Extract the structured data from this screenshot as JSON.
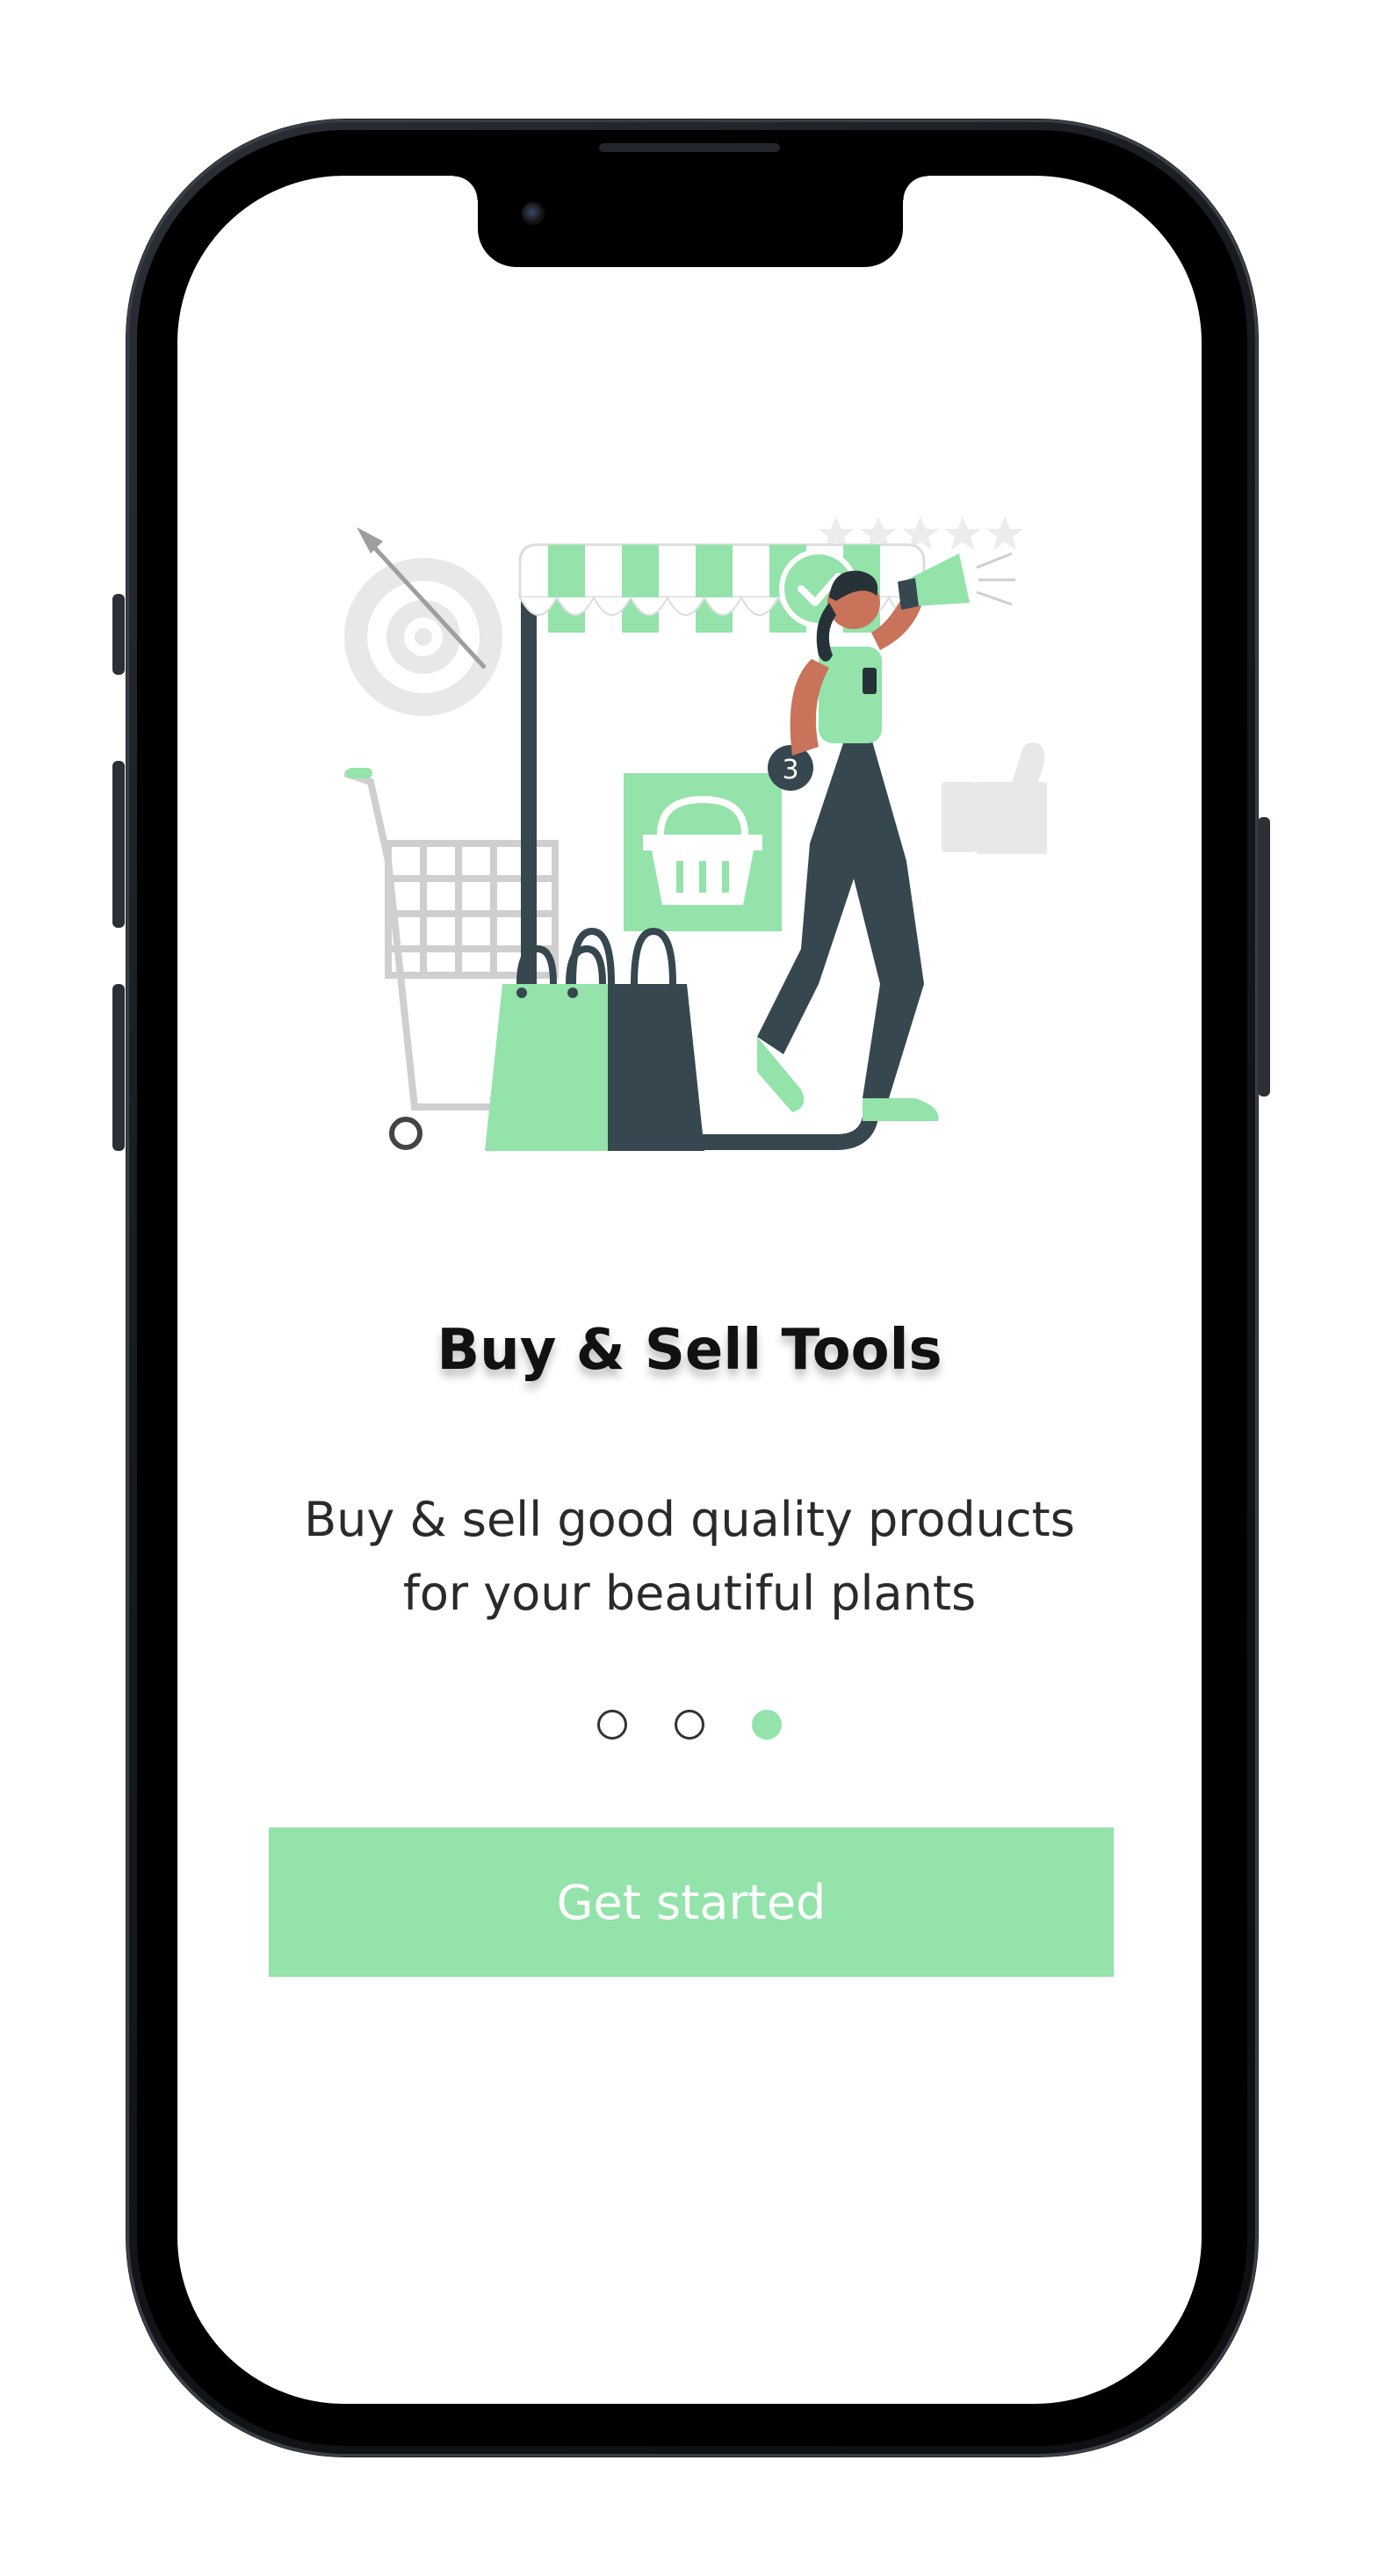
{
  "onboarding": {
    "title": "Buy & Sell Tools",
    "subtitle_line1": "Buy & sell good quality products",
    "subtitle_line2": "for your beautiful plants",
    "page_indicator": {
      "total": 3,
      "current": 3
    },
    "cta_label": "Get started",
    "illustration_badge": "3"
  },
  "colors": {
    "accent": "#93e3aa",
    "dark": "#37474f",
    "skin": "#c8735a",
    "text": "#111111"
  },
  "icons": {
    "illustration": "shop-illustration",
    "basket": "shopping-basket-icon",
    "check": "check-icon",
    "megaphone": "megaphone-icon",
    "thumbs_up": "thumbs-up-icon",
    "target": "target-icon",
    "stars": "rating-stars-icon",
    "cart": "shopping-cart-icon"
  }
}
